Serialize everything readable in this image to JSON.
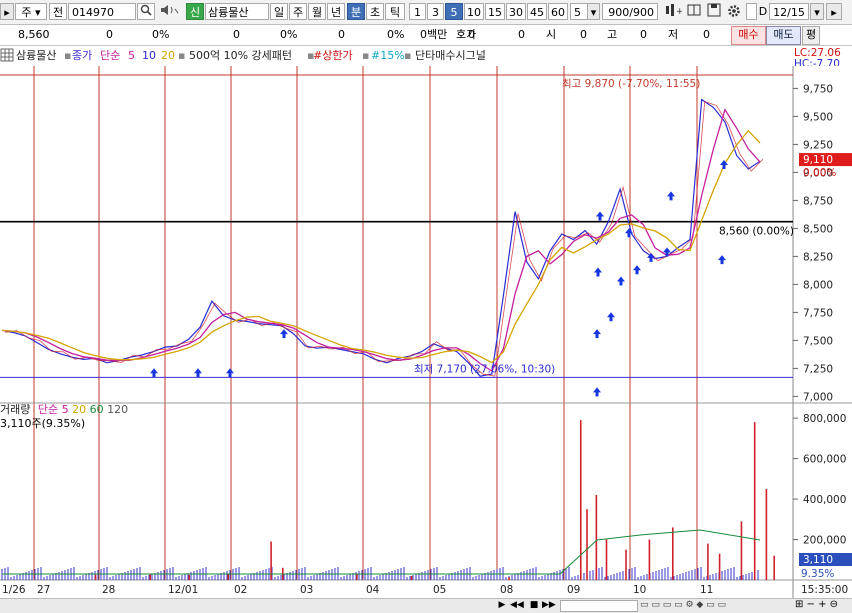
{
  "toolbar": {
    "stock_type": "주",
    "market": "전",
    "code": "014970",
    "badge": "신",
    "name": "삼륭물산",
    "periods": [
      "일",
      "주",
      "월",
      "년",
      "분",
      "초",
      "틱"
    ],
    "active_period": "분",
    "minute_options": [
      "1",
      "3",
      "5",
      "10",
      "15",
      "30",
      "45",
      "60"
    ],
    "active_minute": "5",
    "interval_value": "5",
    "count": "900/900",
    "d_label": "D",
    "date": "12/15"
  },
  "infobar": {
    "price": "8,560",
    "change": "0",
    "change_pct": "0%",
    "v1": "0",
    "v1_pct": "0%",
    "v2": "0",
    "v2_pct": "0%",
    "amount": "0백만",
    "quote_label": "호가",
    "quote": "0",
    "q2": "0",
    "open_label": "시",
    "open": "0",
    "high_label": "고",
    "high": "0",
    "low_label": "저",
    "low": "0",
    "buy": "매수",
    "sell": "매도",
    "avg": "평"
  },
  "legend": {
    "name": "삼륭물산",
    "close": "종가",
    "ma_label": "단순",
    "ma": [
      "5",
      "10",
      "20"
    ],
    "trade": "500억 10% 강세패턴",
    "upper": "#상한가",
    "pct15": "#15%",
    "signal": "단타매수시그널",
    "lc": "LC:27.06",
    "hc": "HC:-7.70"
  },
  "colors": {
    "price_line": "#2b2bd4",
    "ma5": "#c41f9d",
    "ma10": "#d4a400",
    "date_line": "#c0392b",
    "current_price": "#e01b1b",
    "volume_bar": "#3333cc"
  },
  "chart_data": [
    {
      "type": "line",
      "title": "",
      "y_ticks": [
        "9,750",
        "9,500",
        "9,250",
        "9,000",
        "8,750",
        "8,500",
        "8,250",
        "8,000",
        "7,750",
        "7,500",
        "7,250",
        "7,000"
      ],
      "ylim": [
        6950,
        9950
      ],
      "dates": [
        "1/26",
        "27",
        "28",
        "12/01",
        "02",
        "03",
        "04",
        "05",
        "08",
        "09",
        "10",
        "11"
      ],
      "series": [
        {
          "values": [
            7590,
            7570,
            7540,
            7480,
            7420,
            7380,
            7350,
            7330,
            7340,
            7300,
            7320,
            7350,
            7370,
            7400,
            7440,
            7450,
            7510,
            7620,
            7850,
            7720,
            7680,
            7670,
            7650,
            7640,
            7630,
            7560,
            7450,
            7430,
            7440,
            7420,
            7400,
            7380,
            7330,
            7300,
            7340,
            7360,
            7400,
            7470,
            7430,
            7400,
            7300,
            7180,
            7200,
            7900,
            8650,
            8200,
            8050,
            8300,
            8450,
            8400,
            8480,
            8360,
            8560,
            8850,
            8450,
            8300,
            8230,
            8250,
            8330,
            8400,
            9650,
            9580,
            9450,
            9150,
            9030,
            9100
          ]
        }
      ],
      "high_label": "최고 9,870 (-7.70%, 11:55)",
      "low_label": "최저 7,170 (27.06%, 10:30)",
      "ref_label": "8,560 (0.00%)",
      "current_price": "9,110",
      "current_pct": "0.00%",
      "high": 9870,
      "low": 7170,
      "ref": 8560
    },
    {
      "type": "bar",
      "title": "",
      "legend": "거래량",
      "ma_label": "단순",
      "ma": [
        "5",
        "20",
        "60",
        "120"
      ],
      "volume_text": "3,110주(9.35%)",
      "y_ticks": [
        "800,000",
        "600,000",
        "400,000",
        "200,000"
      ],
      "ylim": [
        0,
        860000
      ],
      "current": "3,110",
      "current_pct": "9.35%",
      "time_label": "15:35:00",
      "spikes": [
        {
          "t": 0.12,
          "v": 25000
        },
        {
          "t": 0.19,
          "v": 30000
        },
        {
          "t": 0.24,
          "v": 25000
        },
        {
          "t": 0.29,
          "v": 30000
        },
        {
          "t": 0.345,
          "v": 190000
        },
        {
          "t": 0.36,
          "v": 60000
        },
        {
          "t": 0.455,
          "v": 30000
        },
        {
          "t": 0.525,
          "v": 20000
        },
        {
          "t": 0.65,
          "v": 15000
        },
        {
          "t": 0.742,
          "v": 790000
        },
        {
          "t": 0.75,
          "v": 350000
        },
        {
          "t": 0.762,
          "v": 420000
        },
        {
          "t": 0.775,
          "v": 200000
        },
        {
          "t": 0.8,
          "v": 150000
        },
        {
          "t": 0.83,
          "v": 200000
        },
        {
          "t": 0.86,
          "v": 260000
        },
        {
          "t": 0.905,
          "v": 180000
        },
        {
          "t": 0.92,
          "v": 130000
        },
        {
          "t": 0.948,
          "v": 290000
        },
        {
          "t": 0.965,
          "v": 780000
        },
        {
          "t": 0.98,
          "v": 450000
        },
        {
          "t": 0.99,
          "v": 120000
        }
      ]
    }
  ]
}
